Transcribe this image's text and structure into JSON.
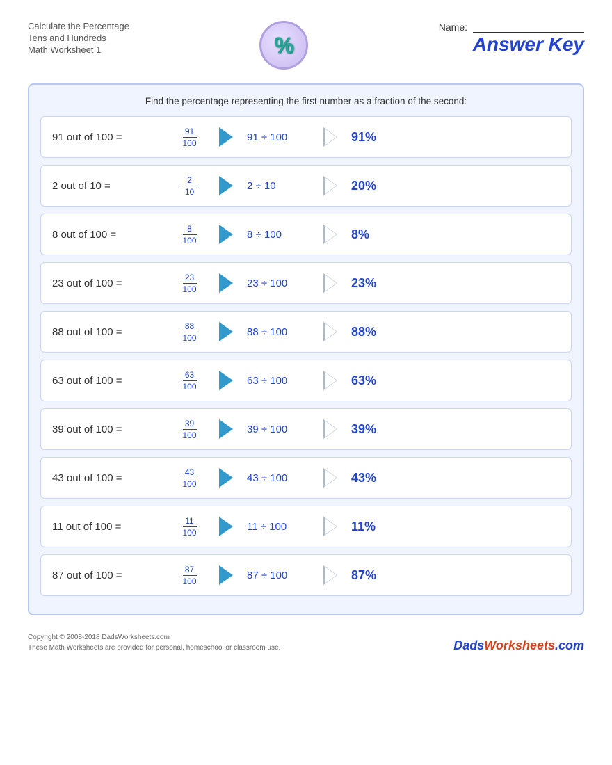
{
  "header": {
    "title_line1": "Calculate the Percentage",
    "title_line2": "Tens and Hundreds",
    "title_line3": "Math Worksheet 1",
    "percent_symbol": "%",
    "name_label": "Name:",
    "answer_key_label": "Answer Key"
  },
  "instructions": "Find the percentage representing the first number as a fraction of the second:",
  "problems": [
    {
      "text": "91 out of 100 =",
      "numerator": "91",
      "denominator": "100",
      "division": "91 ÷ 100",
      "answer": "91%"
    },
    {
      "text": "2 out of 10 =",
      "numerator": "2",
      "denominator": "10",
      "division": "2 ÷ 10",
      "answer": "20%"
    },
    {
      "text": "8 out of 100 =",
      "numerator": "8",
      "denominator": "100",
      "division": "8 ÷ 100",
      "answer": "8%"
    },
    {
      "text": "23 out of 100 =",
      "numerator": "23",
      "denominator": "100",
      "division": "23 ÷ 100",
      "answer": "23%"
    },
    {
      "text": "88 out of 100 =",
      "numerator": "88",
      "denominator": "100",
      "division": "88 ÷ 100",
      "answer": "88%"
    },
    {
      "text": "63 out of 100 =",
      "numerator": "63",
      "denominator": "100",
      "division": "63 ÷ 100",
      "answer": "63%"
    },
    {
      "text": "39 out of 100 =",
      "numerator": "39",
      "denominator": "100",
      "division": "39 ÷ 100",
      "answer": "39%"
    },
    {
      "text": "43 out of 100 =",
      "numerator": "43",
      "denominator": "100",
      "division": "43 ÷ 100",
      "answer": "43%"
    },
    {
      "text": "11 out of 100 =",
      "numerator": "11",
      "denominator": "100",
      "division": "11 ÷ 100",
      "answer": "11%"
    },
    {
      "text": "87 out of 100 =",
      "numerator": "87",
      "denominator": "100",
      "division": "87 ÷ 100",
      "answer": "87%"
    }
  ],
  "footer": {
    "copyright": "Copyright © 2008-2018 DadsWorksheets.com",
    "notice": "These Math Worksheets are provided for personal, homeschool or classroom use.",
    "logo": "DadsWorksheets.com"
  }
}
